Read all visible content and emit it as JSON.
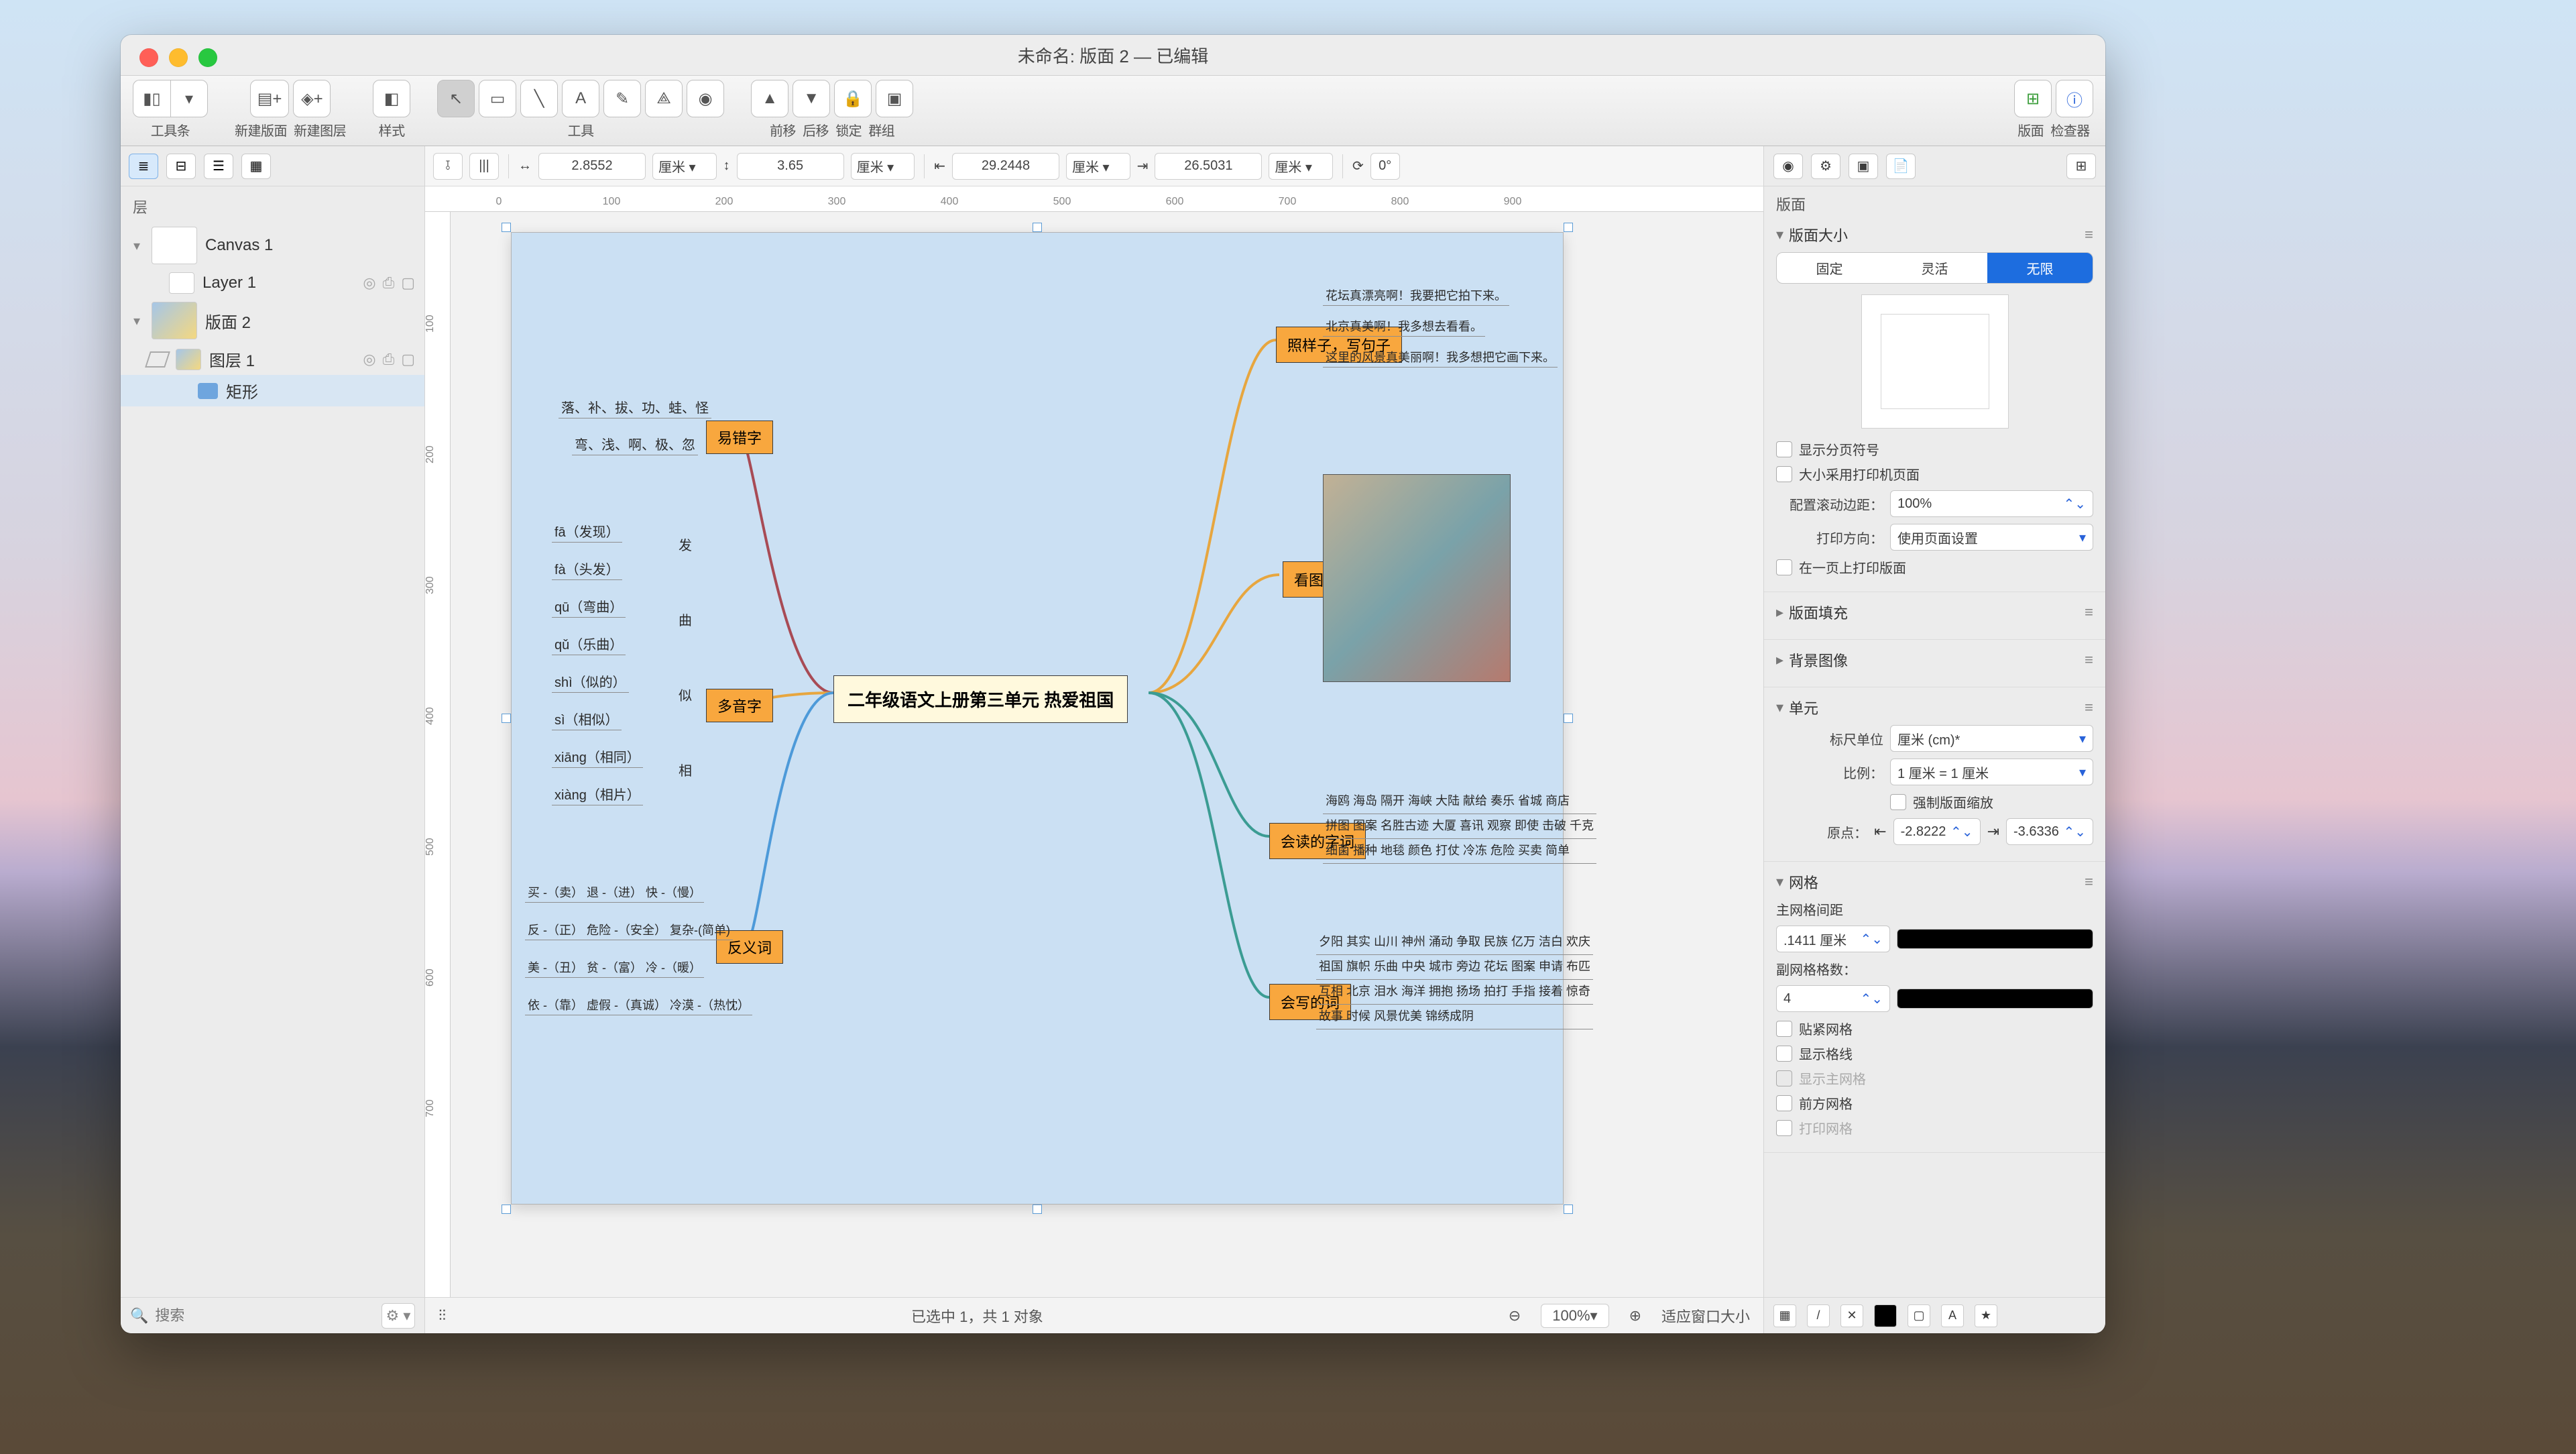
{
  "window": {
    "title": "未命名: 版面 2 — 已编辑"
  },
  "toolbar": {
    "groups": {
      "toolbar_btn": "工具条",
      "new_canvas": "新建版面",
      "new_layer": "新建图层",
      "style": "样式",
      "tools": "工具",
      "forward": "前移",
      "backward": "后移",
      "lock": "锁定",
      "group": "群组",
      "canvas": "版面",
      "inspector": "检查器"
    }
  },
  "properties_bar": {
    "w_value": "2.8552",
    "w_unit": "厘米 ▾",
    "h_value": "3.65",
    "h_unit": "厘米 ▾",
    "x_value": "29.2448",
    "x_unit": "厘米 ▾",
    "y_value": "26.5031",
    "y_unit": "厘米 ▾",
    "rot": "0°"
  },
  "sidebar": {
    "section_title": "层",
    "search_placeholder": "搜索",
    "items": [
      {
        "name": "Canvas 1",
        "type": "canvas",
        "expanded": true
      },
      {
        "name": "Layer 1",
        "type": "layer"
      },
      {
        "name": "版面 2",
        "type": "canvas",
        "expanded": true,
        "filled": true
      },
      {
        "name": "图层 1",
        "type": "layer"
      },
      {
        "name": "矩形",
        "type": "shape",
        "selected": true
      }
    ]
  },
  "ruler": {
    "h_ticks": [
      "0",
      "100",
      "200",
      "300",
      "400",
      "500",
      "600",
      "700",
      "800",
      "900"
    ],
    "v_ticks": [
      "100",
      "200",
      "300",
      "400",
      "500",
      "600",
      "700"
    ]
  },
  "status": {
    "selection": "已选中 1，共 1 对象",
    "zoom": "100%",
    "fit": "适应窗口大小"
  },
  "inspector": {
    "canvas_title": "版面",
    "page_size": {
      "title": "版面大小",
      "seg": [
        "固定",
        "灵活",
        "无限"
      ],
      "active": 2,
      "show_page_breaks": "显示分页符号",
      "use_printer": "大小采用打印机页面",
      "scroll_margin_label": "配置滚动边距：",
      "scroll_margin_value": "100%",
      "print_orientation_label": "打印方向：",
      "print_orientation_value": "使用页面设置",
      "one_page": "在一页上打印版面"
    },
    "canvas_fill": "版面填充",
    "bg_image": "背景图像",
    "units": {
      "title": "单元",
      "ruler_units_label": "标尺单位",
      "ruler_units_value": "厘米 (cm)*",
      "scale_label": "比例：",
      "scale_value": "1 厘米 = 1 厘米",
      "force_scale": "强制版面缩放",
      "origin_label": "原点：",
      "origin_x": "-2.8222",
      "origin_y": "-3.6336"
    },
    "grid": {
      "title": "网格",
      "main_spacing_label": "主网格间距",
      "main_spacing_value": ".1411 厘米",
      "sub_count_label": "副网格格数：",
      "sub_count_value": "4",
      "snap": "贴紧网格",
      "show_lines": "显示格线",
      "show_main": "显示主网格",
      "front": "前方网格",
      "print": "打印网格"
    }
  },
  "mindmap": {
    "center": "二年级语文上册第三单元  热爱祖国",
    "branches": {
      "hard_chars": {
        "label": "易错字",
        "lines": [
          "落、补、拔、功、蛙、怪",
          "弯、浅、啊、极、忽"
        ]
      },
      "polyphonic": {
        "label": "多音字",
        "items": [
          "fā（发现）",
          "fà（头发）",
          "qū（弯曲）",
          "qǔ（乐曲）",
          "shì（似的）",
          "sì（相似）",
          "xiāng（相同）",
          "xiàng（相片）"
        ],
        "group_labels": [
          "发",
          "曲",
          "似",
          "相"
        ]
      },
      "antonyms": {
        "label": "反义词",
        "lines": [
          "买 -（卖）  退 -（进） 快 -（慢）",
          "反 -（正） 危险 -（安全） 复杂-(简单)",
          "美 -（丑） 贫 -（富） 冷 -（暖）",
          "依 -（靠） 虚假 -（真诚） 冷漠 -（热忱）"
        ]
      },
      "sentence": {
        "label": "照样子，写句子",
        "lines": [
          "花坛真漂亮啊！我要把它拍下来。",
          "北京真美啊！我多想去看看。",
          "这里的风景真美丽啊！我多想把它画下来。"
        ]
      },
      "picture_writing": {
        "label": "看图写话"
      },
      "reading_words": {
        "label": "会读的字词",
        "lines": [
          "海鸥 海岛 隔开 海峡 大陆 献给 奏乐 省城 商店",
          "拼图 图案 名胜古迹 大厦 喜讯 观察 即使 击破 千克",
          "细菌 播种 地毯 颜色 打仗 冷冻 危险 买卖 简单"
        ]
      },
      "writing_words": {
        "label": "会写的词",
        "lines": [
          "夕阳 其实 山川 神州 涌动 争取 民族 亿万 洁白 欢庆",
          "祖国 旗帜 乐曲 中央 城市 旁边 花坛 图案 申请 布匹",
          "互相 北京 泪水 海洋 拥抱 扬场 拍打 手指 接着 惊奇",
          "故事 时候 风景优美 锦绣成阴"
        ]
      }
    }
  }
}
